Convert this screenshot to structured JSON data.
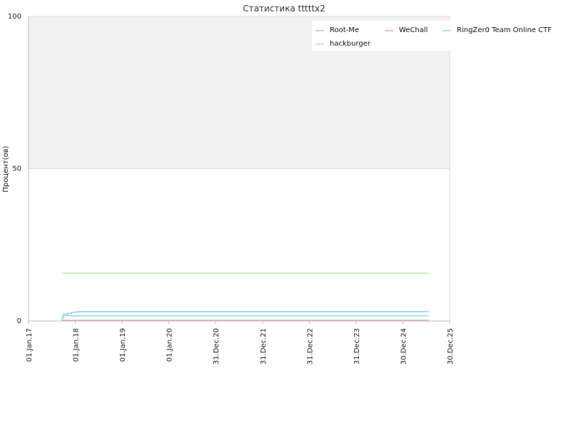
{
  "chart_data": {
    "type": "line",
    "title": "Статистика tttttx2",
    "xlabel": "",
    "ylabel": "Процент(ов)",
    "ylim": [
      0,
      100
    ],
    "y_ticks": [
      "0",
      "50",
      "100"
    ],
    "x_ticks": [
      "01.Jan.17",
      "01.Jan.18",
      "01.Jan.19",
      "01.Jan.20",
      "31.Dec.20",
      "31.Dec.21",
      "31.Dec.22",
      "31.Dec.23",
      "30.Dec.24",
      "30.Dec.25"
    ],
    "xlim": [
      "2017-01-01",
      "2025-12-30"
    ],
    "grid": true,
    "legend_position": "top-right",
    "background_bands": [
      "#f2f2f2",
      "#ffffff"
    ],
    "series": [
      {
        "name": "Root-Me",
        "color": "#9ec9f2",
        "points": [
          [
            "2017-09-20",
            0
          ],
          [
            "2017-09-22",
            1.5
          ],
          [
            "2017-10-01",
            2.2
          ],
          [
            "2017-11-01",
            2.5
          ],
          [
            "2017-12-01",
            2.8
          ],
          [
            "2018-01-01",
            3.0
          ],
          [
            "2018-02-01",
            3.1
          ],
          [
            "2025-07-20",
            3.1
          ]
        ]
      },
      {
        "name": "WeChall",
        "color": "#f2a6c8",
        "points": [
          [
            "2017-09-20",
            0.2
          ],
          [
            "2025-07-20",
            0.2
          ]
        ]
      },
      {
        "name": "RingZer0 Team Online CTF",
        "color": "#8fe0d6",
        "points": [
          [
            "2017-09-20",
            0
          ],
          [
            "2017-09-22",
            1.3
          ],
          [
            "2017-10-01",
            1.7
          ],
          [
            "2025-07-20",
            1.7
          ]
        ]
      },
      {
        "name": "hackburger",
        "color": "#b4ec9c",
        "points": [
          [
            "2017-09-20",
            15.7
          ],
          [
            "2025-07-20",
            15.7
          ]
        ]
      }
    ]
  }
}
